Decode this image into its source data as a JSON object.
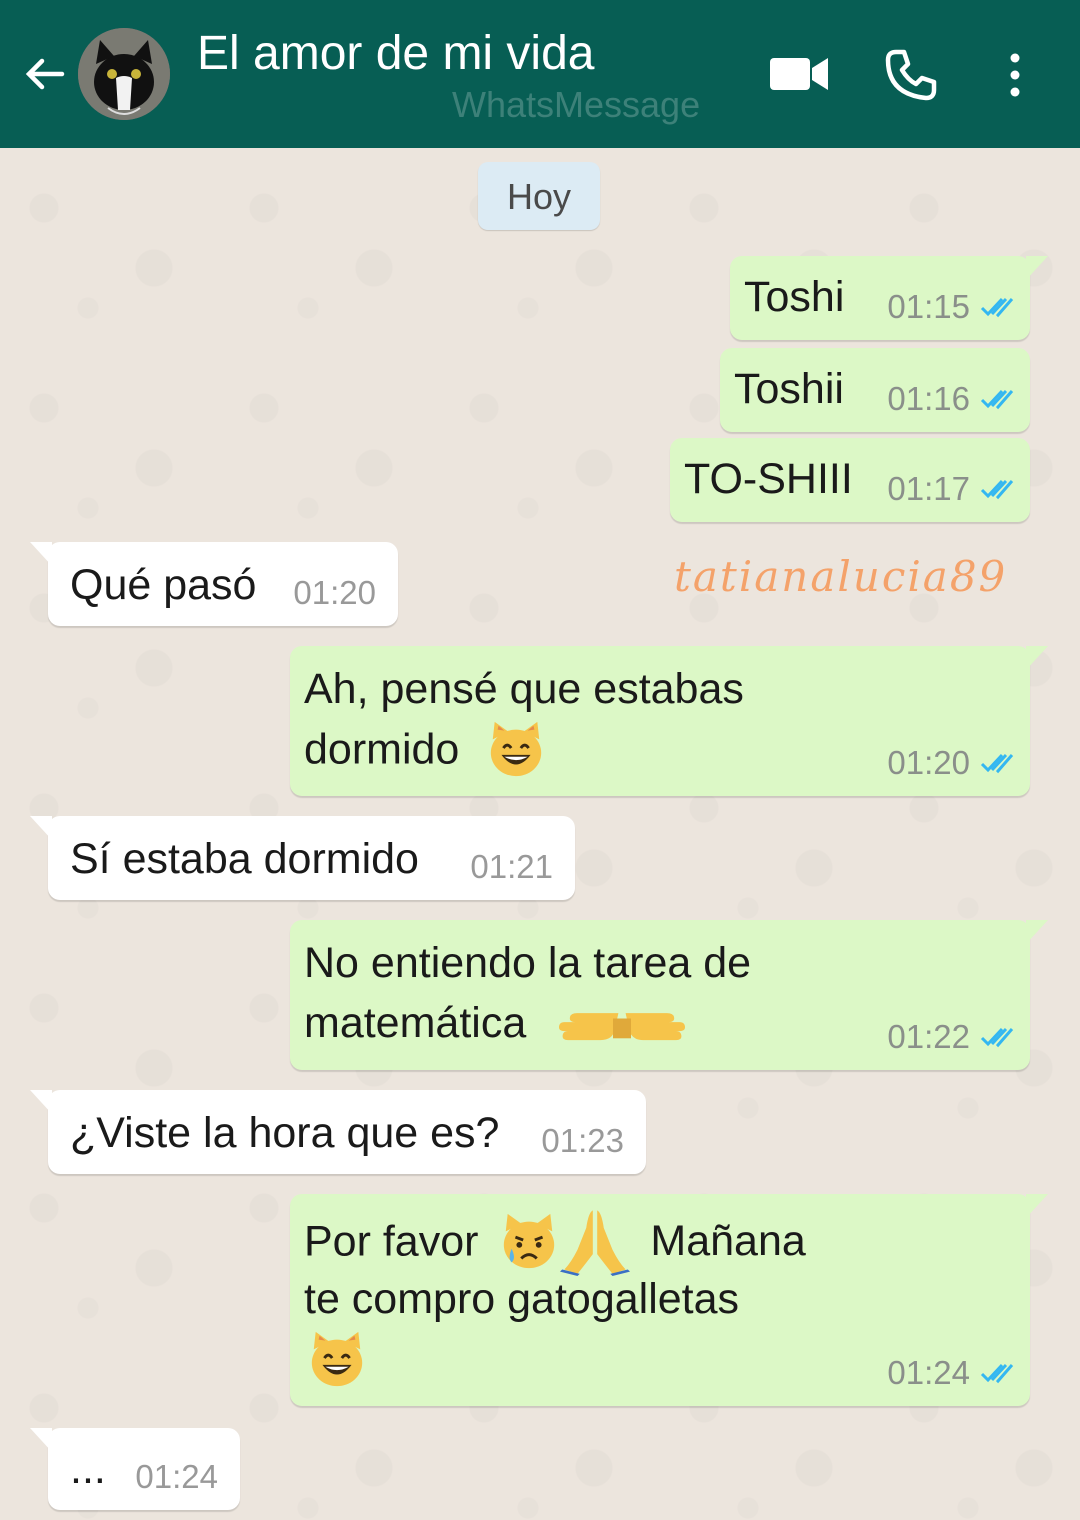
{
  "header": {
    "title": "El amor de mi vida",
    "app_watermark": "WhatsMessage",
    "background_color": "#075e54",
    "icons": [
      "back-arrow-icon",
      "contact-avatar",
      "video-call-icon",
      "phone-icon",
      "more-options-icon"
    ]
  },
  "date_chip": "Hoy",
  "signature": "tatianalucia89",
  "colors": {
    "outgoing_bubble": "#dcf8c6",
    "incoming_bubble": "#ffffff",
    "read_ticks": "#34b7f1",
    "chat_background": "#ece5dd"
  },
  "messages": [
    {
      "direction": "out",
      "line1": "Toshi",
      "time": "01:15",
      "status": "read"
    },
    {
      "direction": "out",
      "line1": "Toshii",
      "time": "01:16",
      "status": "read"
    },
    {
      "direction": "out",
      "line1": "TO-SHIII",
      "time": "01:17",
      "status": "read"
    },
    {
      "direction": "in",
      "line1": "Qué pasó",
      "time": "01:20"
    },
    {
      "direction": "out",
      "line1": "Ah, pensé que estabas",
      "line2": "dormido",
      "emojis": [
        "grinning-cat-emoji"
      ],
      "time": "01:20",
      "status": "read"
    },
    {
      "direction": "in",
      "line1": "Sí estaba dormido",
      "time": "01:21"
    },
    {
      "direction": "out",
      "line1": "No entiendo la tarea de",
      "line2": "matemática",
      "emojis": [
        "pointing-left-emoji",
        "pointing-right-emoji"
      ],
      "time": "01:22",
      "status": "read"
    },
    {
      "direction": "in",
      "line1": "¿Viste la hora que es?",
      "time": "01:23"
    },
    {
      "direction": "out",
      "line1a": "Por favor",
      "line1b": "Mañana",
      "line2": "te compro gatogalletas",
      "emojis": [
        "crying-cat-emoji",
        "folded-hands-emoji",
        "grinning-cat-emoji"
      ],
      "time": "01:24",
      "status": "read"
    },
    {
      "direction": "in",
      "line1": "...",
      "time": "01:24"
    }
  ]
}
